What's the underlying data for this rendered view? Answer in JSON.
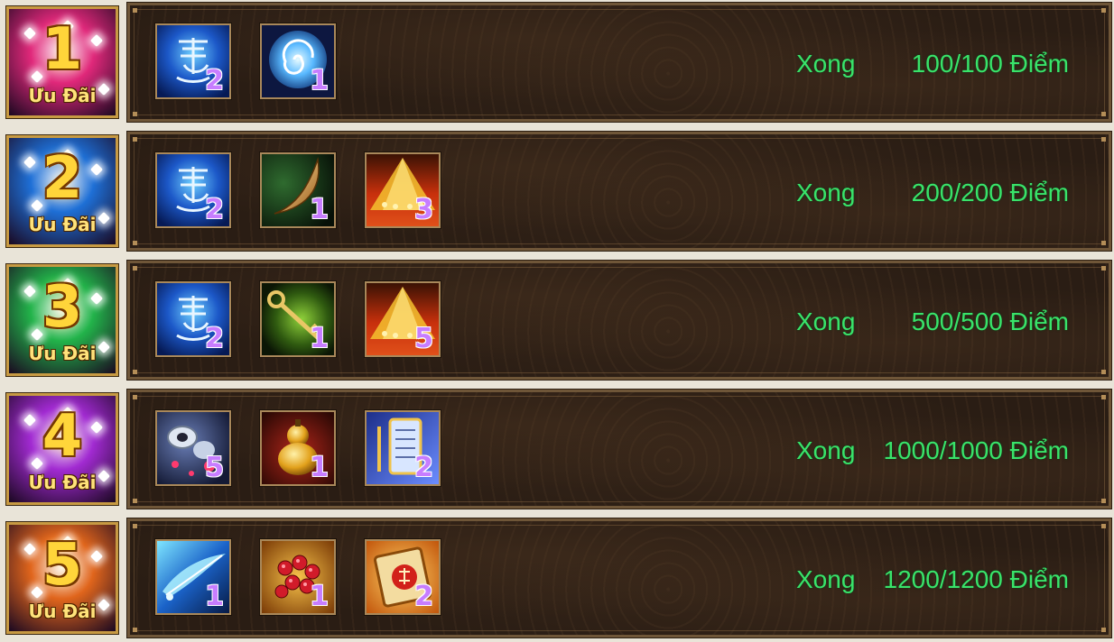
{
  "badge_label": "Ưu Đãi",
  "rows": [
    {
      "number": "1",
      "badge_color": "#e0287a",
      "items": [
        {
          "icon": "blue-scroll-icon",
          "qty": "2"
        },
        {
          "icon": "blue-swirl-orb-icon",
          "qty": "1"
        }
      ],
      "status": "Xong",
      "points": "100/100 Điểm"
    },
    {
      "number": "2",
      "badge_color": "#1e6fd6",
      "items": [
        {
          "icon": "blue-scroll-icon",
          "qty": "2"
        },
        {
          "icon": "golden-horn-icon",
          "qty": "1"
        },
        {
          "icon": "red-gold-tent-icon",
          "qty": "3"
        }
      ],
      "status": "Xong",
      "points": "200/200 Điểm"
    },
    {
      "number": "3",
      "badge_color": "#22b34a",
      "items": [
        {
          "icon": "blue-scroll-icon",
          "qty": "2"
        },
        {
          "icon": "golden-key-icon",
          "qty": "1"
        },
        {
          "icon": "red-gold-tent-icon",
          "qty": "5"
        }
      ],
      "status": "Xong",
      "points": "500/500 Điểm"
    },
    {
      "number": "4",
      "badge_color": "#a12ad1",
      "items": [
        {
          "icon": "potion-bottles-icon",
          "qty": "5"
        },
        {
          "icon": "gold-gourd-icon",
          "qty": "1"
        },
        {
          "icon": "blue-tablet-icon",
          "qty": "2"
        }
      ],
      "status": "Xong",
      "points": "1000/1000 Điểm"
    },
    {
      "number": "5",
      "badge_color": "#e0651c",
      "items": [
        {
          "icon": "blue-feather-icon",
          "qty": "1"
        },
        {
          "icon": "red-berries-icon",
          "qty": "1"
        },
        {
          "icon": "fire-scroll-icon",
          "qty": "2"
        }
      ],
      "status": "Xong",
      "points": "1200/1200 Điểm"
    }
  ]
}
